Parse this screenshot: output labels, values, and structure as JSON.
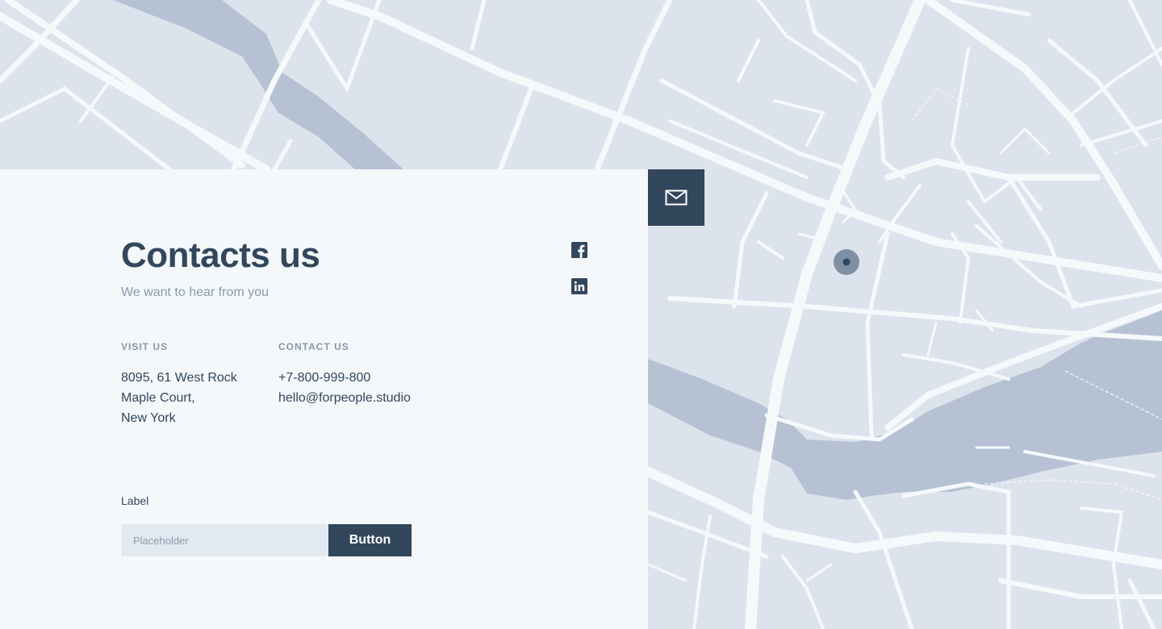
{
  "contact": {
    "title": "Contacts us",
    "subtitle": "We want to hear from you",
    "visit": {
      "heading": "VISIT US",
      "lines": [
        "8095, 61 West Rock",
        "Maple Court,",
        "New York"
      ]
    },
    "contact_info": {
      "heading": "CONTACT US",
      "phone": "+7-800-999-800",
      "email": "hello@forpeople.studio"
    }
  },
  "social": {
    "facebook_icon": "facebook-icon",
    "linkedin_icon": "linkedin-icon"
  },
  "form": {
    "label": "Label",
    "placeholder": "Placeholder",
    "button_label": "Button"
  },
  "map": {
    "mail_icon": "envelope-icon",
    "marker_icon": "location-marker-icon"
  },
  "colors": {
    "primary": "#32465c",
    "panel_bg": "#f4f8fb",
    "map_bg": "#dde3ec",
    "map_road": "#f6f9fc",
    "map_water": "#b6c2d4",
    "muted_text": "#8a9aac"
  }
}
